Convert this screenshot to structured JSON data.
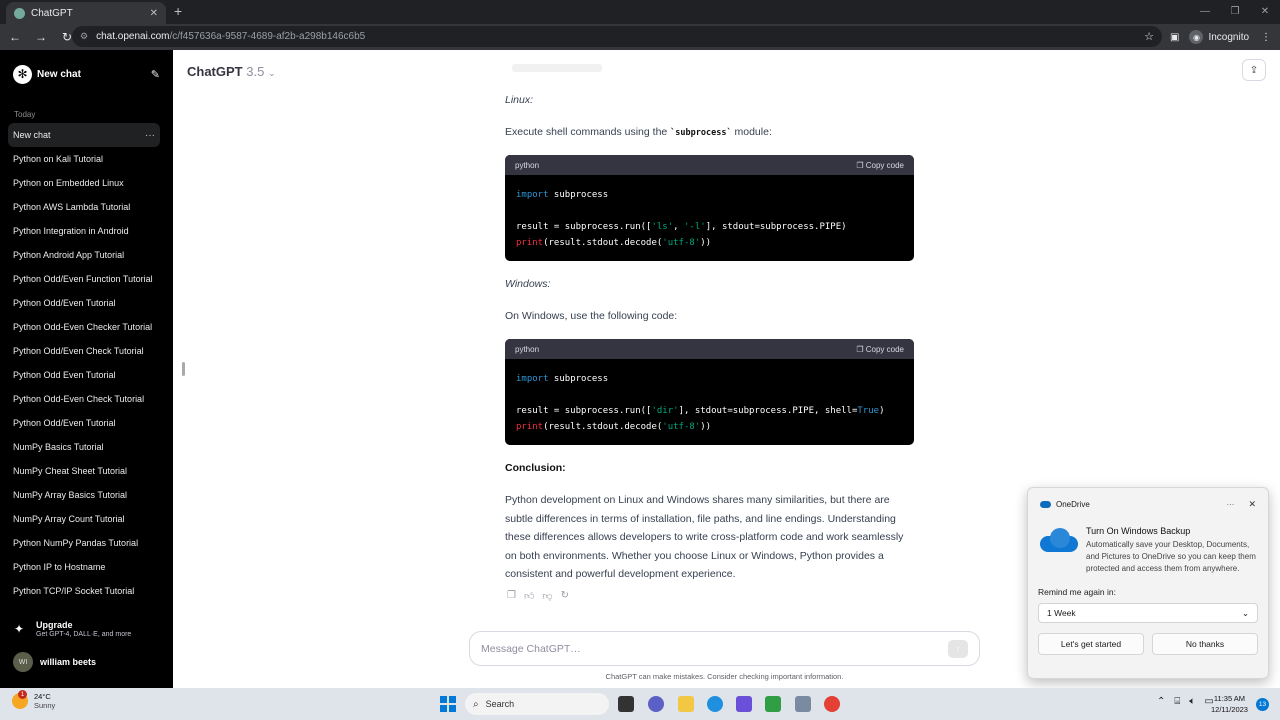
{
  "browser": {
    "tab_title": "ChatGPT",
    "tab_close": "✕",
    "new_tab": "+",
    "url_domain": "chat.openai.com",
    "url_path": "/c/f457636a-9587-4689-af2b-a298b146c6b5",
    "incognito_label": "Incognito"
  },
  "sidebar": {
    "new_chat": "New chat",
    "section_today": "Today",
    "items": [
      {
        "label": "New chat",
        "active": true
      },
      {
        "label": "Python on Kali Tutorial"
      },
      {
        "label": "Python on Embedded Linux"
      },
      {
        "label": "Python AWS Lambda Tutorial"
      },
      {
        "label": "Python Integration in Android"
      },
      {
        "label": "Python Android App Tutorial"
      },
      {
        "label": "Python Odd/Even Function Tutorial"
      },
      {
        "label": "Python Odd/Even Tutorial"
      },
      {
        "label": "Python Odd-Even Checker Tutorial"
      },
      {
        "label": "Python Odd/Even Check Tutorial"
      },
      {
        "label": "Python Odd Even Tutorial"
      },
      {
        "label": "Python Odd-Even Check Tutorial"
      },
      {
        "label": "Python Odd/Even Tutorial"
      },
      {
        "label": "NumPy Basics Tutorial"
      },
      {
        "label": "NumPy Cheat Sheet Tutorial"
      },
      {
        "label": "NumPy Array Basics Tutorial"
      },
      {
        "label": "NumPy Array Count Tutorial"
      },
      {
        "label": "Python NumPy Pandas Tutorial"
      },
      {
        "label": "Python IP to Hostname"
      },
      {
        "label": "Python TCP/IP Socket Tutorial"
      }
    ],
    "upgrade_title": "Upgrade",
    "upgrade_sub": "Get GPT-4, DALL·E, and more",
    "user_initials": "WI",
    "user_name": "william beets"
  },
  "header": {
    "model_name": "ChatGPT",
    "model_version": "3.5"
  },
  "chat": {
    "linux_heading": "Linux:",
    "linux_intro_pre": "Execute shell commands using the ",
    "linux_intro_code": "`subprocess`",
    "linux_intro_post": " module:",
    "code_lang": "python",
    "copy_label": "Copy code",
    "windows_heading": "Windows:",
    "windows_intro": "On Windows, use the following code:",
    "conclusion_heading": "Conclusion:",
    "conclusion_text": "Python development on Linux and Windows shares many similarities, but there are subtle differences in terms of installation, file paths, and line endings. Understanding these differences allows developers to write cross-platform code and work seamlessly on both environments. Whether you choose Linux or Windows, Python provides a consistent and powerful development experience."
  },
  "composer": {
    "placeholder": "Message ChatGPT…",
    "disclaimer": "ChatGPT can make mistakes. Consider checking important information."
  },
  "toast": {
    "app": "OneDrive",
    "more": "···",
    "close": "✕",
    "title": "Turn On Windows Backup",
    "desc": "Automatically save your Desktop, Documents, and Pictures to OneDrive so you can keep them protected and access them from anywhere.",
    "remind_label": "Remind me again in:",
    "remind_value": "1 Week",
    "primary": "Let's get started",
    "secondary": "No thanks"
  },
  "taskbar": {
    "temp": "24°C",
    "condition": "Sunny",
    "weather_badge": "1",
    "search": "Search",
    "time": "11:35 AM",
    "date": "12/11/2023",
    "notifications": "13"
  },
  "colors": {
    "accent": "#10a37f",
    "keyword": "#2e95d3",
    "string": "#00a67d",
    "function": "#f22c3d"
  }
}
